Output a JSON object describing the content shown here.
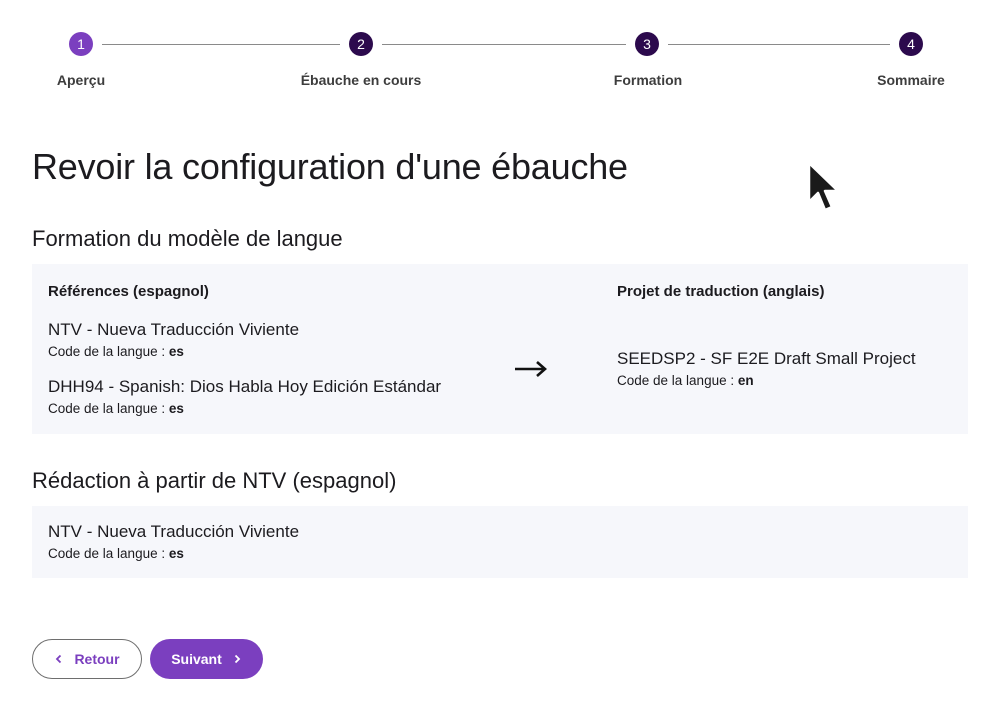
{
  "stepper": {
    "steps": [
      {
        "number": "1",
        "label": "Aperçu"
      },
      {
        "number": "2",
        "label": "Ébauche en cours"
      },
      {
        "number": "3",
        "label": "Formation"
      },
      {
        "number": "4",
        "label": "Sommaire"
      }
    ]
  },
  "page": {
    "title": "Revoir la configuration d'une ébauche"
  },
  "training": {
    "title": "Formation du modèle de langue",
    "source_heading": "Références (espagnol)",
    "target_heading": "Projet de traduction (anglais)",
    "language_code_label": "Code de la langue :",
    "sources": [
      {
        "name": "NTV - Nueva Traducción Viviente",
        "code": "es"
      },
      {
        "name": "DHH94 - Spanish: Dios Habla Hoy Edición Estándar",
        "code": "es"
      }
    ],
    "target": {
      "name": "SEEDSP2 - SF E2E Draft Small Project",
      "code": "en"
    }
  },
  "drafting": {
    "title": "Rédaction à partir de NTV (espagnol)",
    "language_code_label": "Code de la langue :",
    "source": {
      "name": "NTV - Nueva Traducción Viviente",
      "code": "es"
    }
  },
  "actions": {
    "back_label": "Retour",
    "next_label": "Suivant"
  },
  "colors": {
    "accent": "#7b3fbf",
    "step_done": "#2c0a4d",
    "panel_bg": "#f6f7fb"
  }
}
